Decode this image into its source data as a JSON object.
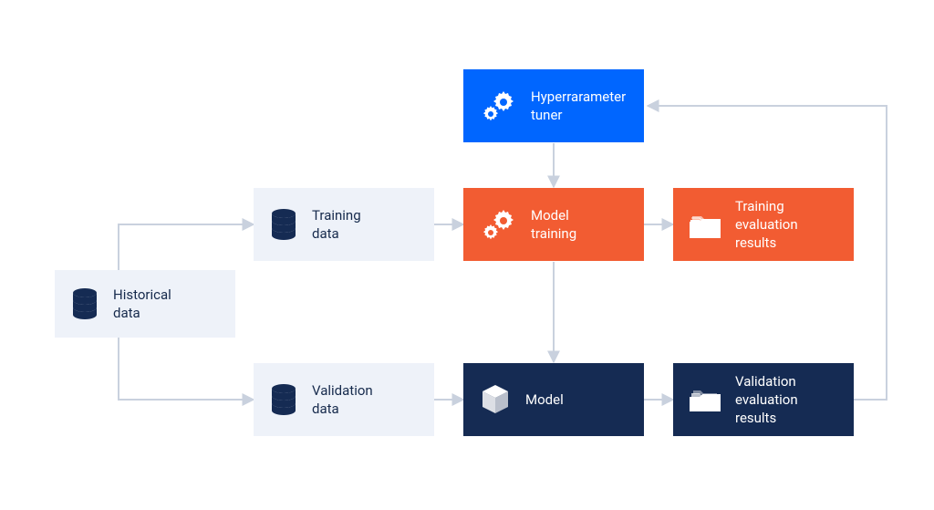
{
  "diagram": {
    "nodes": {
      "historical": {
        "label": "Historical\ndata",
        "icon": "database-icon",
        "style": "light"
      },
      "training_data": {
        "label": "Training\ndata",
        "icon": "database-icon",
        "style": "light"
      },
      "validation_data": {
        "label": "Validation\ndata",
        "icon": "database-icon",
        "style": "light"
      },
      "hyper_tuner": {
        "label": "Hyperrarameter\ntuner",
        "icon": "gears-icon",
        "style": "blue"
      },
      "model_training": {
        "label": "Model\ntraining",
        "icon": "gears-icon",
        "style": "orange"
      },
      "training_results": {
        "label": "Training\nevaluation\nresults",
        "icon": "folder-icon",
        "style": "orange"
      },
      "model": {
        "label": "Model",
        "icon": "cube-icon",
        "style": "navy"
      },
      "validation_results": {
        "label": "Validation\nevaluation\nresults",
        "icon": "folder-icon",
        "style": "navy"
      }
    },
    "edges": [
      {
        "from": "historical",
        "to": "training_data"
      },
      {
        "from": "historical",
        "to": "validation_data"
      },
      {
        "from": "training_data",
        "to": "model_training"
      },
      {
        "from": "validation_data",
        "to": "model"
      },
      {
        "from": "hyper_tuner",
        "to": "model_training"
      },
      {
        "from": "model_training",
        "to": "training_results"
      },
      {
        "from": "model_training",
        "to": "model"
      },
      {
        "from": "model",
        "to": "validation_results"
      },
      {
        "from": "validation_results",
        "to": "hyper_tuner"
      }
    ],
    "colors": {
      "light_bg": "#eef2f9",
      "blue": "#0066ff",
      "orange": "#f25c32",
      "navy": "#152b53",
      "arrow": "#c9d1de"
    }
  }
}
